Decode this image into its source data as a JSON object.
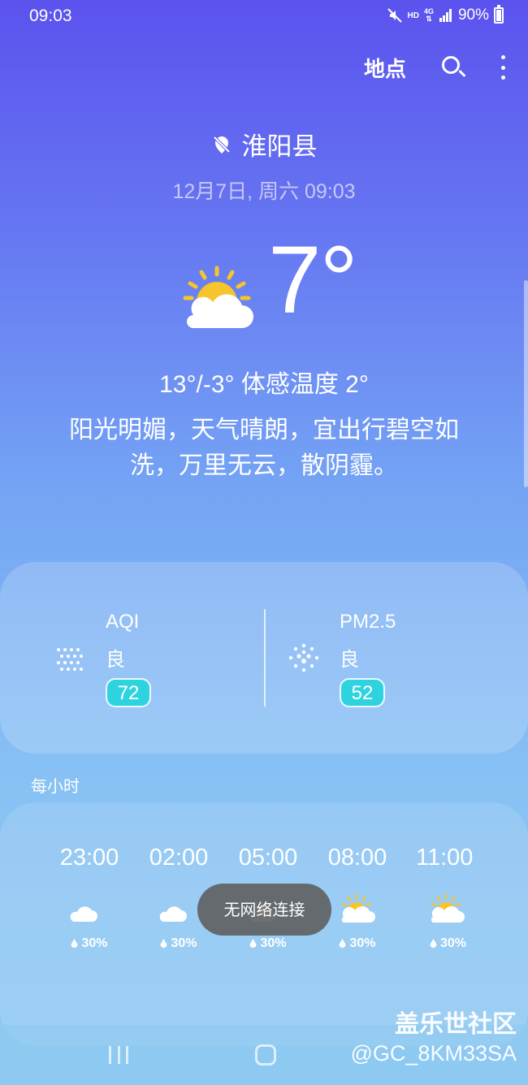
{
  "status_bar": {
    "time": "09:03",
    "hd": "HD",
    "network": "4G",
    "battery": "90%"
  },
  "header": {
    "location_label": "地点"
  },
  "location": {
    "city": "淮阳县",
    "datetime": "12月7日, 周六 09:03"
  },
  "current": {
    "temperature": "7°",
    "range_feels": "13°/-3° 体感温度 2°",
    "description": "阳光明媚，天气晴朗，宜出行碧空如洗，万里无云，散阴霾。",
    "icon": "partly-sunny-icon"
  },
  "air": {
    "aqi": {
      "label": "AQI",
      "level": "良",
      "value": "72"
    },
    "pm25": {
      "label": "PM2.5",
      "level": "良",
      "value": "52"
    },
    "badge_color": "#2fd3df"
  },
  "hourly": {
    "title": "每小时",
    "items": [
      {
        "time": "23:00",
        "icon": "moon-cloud-icon",
        "precip": "30%"
      },
      {
        "time": "02:00",
        "icon": "moon-cloud-icon",
        "precip": "30%"
      },
      {
        "time": "05:00",
        "icon": "moon-cloud-icon",
        "precip": "30%"
      },
      {
        "time": "08:00",
        "icon": "sun-cloud-icon",
        "precip": "30%"
      },
      {
        "time": "11:00",
        "icon": "sun-cloud-icon",
        "precip": "30%"
      }
    ]
  },
  "toast": "无网络连接",
  "watermark": {
    "line1": "盖乐世社区",
    "line2": "@GC_8KM33SA"
  }
}
